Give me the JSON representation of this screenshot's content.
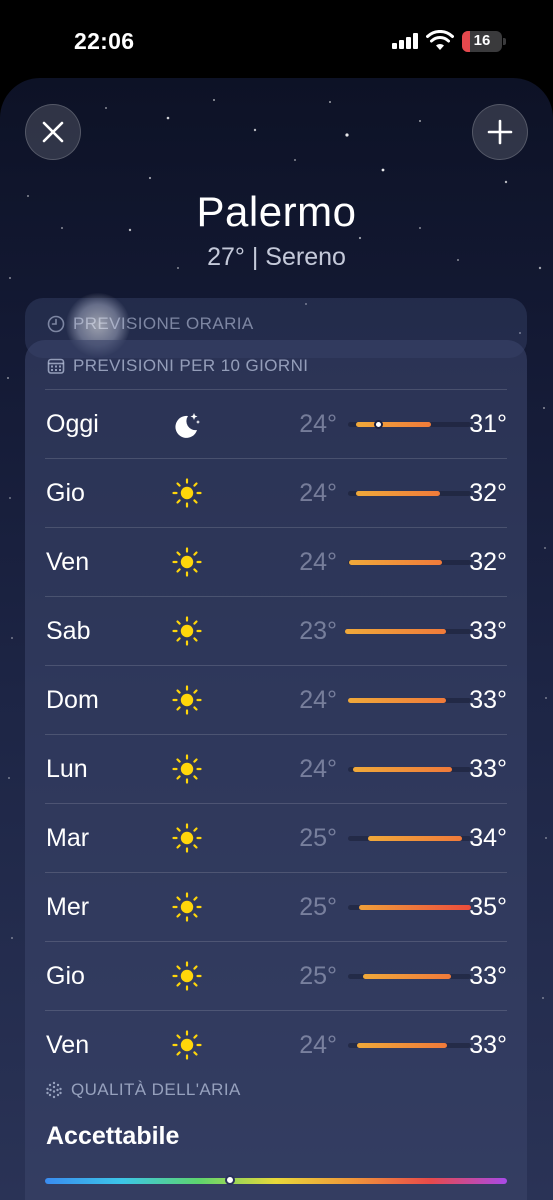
{
  "status": {
    "time": "22:06",
    "battery": "16"
  },
  "header": {
    "city": "Palermo",
    "subtitle": "27° | Sereno"
  },
  "hourly": {
    "title": "PREVISIONE ORARIA"
  },
  "forecast": {
    "title": "PREVISIONI PER 10 GIORNI",
    "days": [
      {
        "day": "Oggi",
        "icon": "moon-stars-icon",
        "low": "24°",
        "high": "31°"
      },
      {
        "day": "Gio",
        "icon": "sun-icon",
        "low": "24°",
        "high": "32°"
      },
      {
        "day": "Ven",
        "icon": "sun-icon",
        "low": "24°",
        "high": "32°"
      },
      {
        "day": "Sab",
        "icon": "sun-icon",
        "low": "23°",
        "high": "33°"
      },
      {
        "day": "Dom",
        "icon": "sun-icon",
        "low": "24°",
        "high": "33°"
      },
      {
        "day": "Lun",
        "icon": "sun-icon",
        "low": "24°",
        "high": "33°"
      },
      {
        "day": "Mar",
        "icon": "sun-icon",
        "low": "25°",
        "high": "34°"
      },
      {
        "day": "Mer",
        "icon": "sun-icon",
        "low": "25°",
        "high": "35°"
      },
      {
        "day": "Gio",
        "icon": "sun-icon",
        "low": "25°",
        "high": "33°"
      },
      {
        "day": "Ven",
        "icon": "sun-icon",
        "low": "24°",
        "high": "33°"
      }
    ]
  },
  "air_quality": {
    "title": "QUALITÀ DELL'ARIA",
    "value": "Accettabile"
  },
  "colors": {
    "bar_start": "#f0a93a",
    "bar_end": "#f07a3a",
    "bar_hot_end": "#ec4c3c",
    "sun": "#ffd60a"
  }
}
